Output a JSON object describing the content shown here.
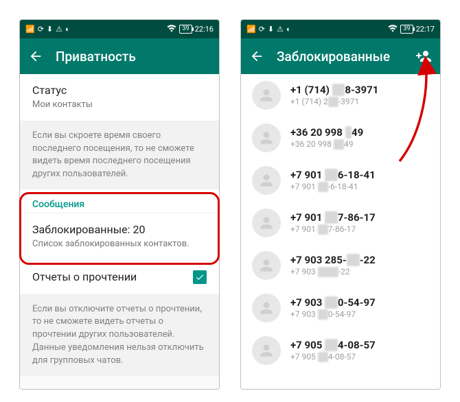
{
  "colors": {
    "teal_dark": "#004d40",
    "teal": "#00796b",
    "accent": "#009688",
    "highlight": "#d60000"
  },
  "left": {
    "status": {
      "time": "22:16",
      "battery": "39",
      "icons": [
        "signal",
        "sync",
        "download",
        "warn",
        "refresh"
      ],
      "wifi": true
    },
    "appbar": {
      "title": "Приватность"
    },
    "status_row": {
      "label": "Статус",
      "value": "Мои контакты"
    },
    "caption1": "Если вы скроете время своего последнего посещения, то не сможете видеть время последнего посещения других пользователей.",
    "section": "Сообщения",
    "blocked_row": {
      "label": "Заблокированные: 20",
      "sub": "Список заблокированных контактов."
    },
    "readreceipts": {
      "label": "Отчеты о прочтении",
      "checked": true
    },
    "caption2": "Если вы отключите отчеты о прочтении, то не сможете видеть отчеты о прочтении других пользователей. Данные уведомления нельзя отключить для групповых чатов."
  },
  "right": {
    "status": {
      "time": "22:17",
      "battery": "39",
      "icons": [
        "signal",
        "sync",
        "download",
        "warn",
        "refresh"
      ],
      "wifi": true
    },
    "appbar": {
      "title": "Заблокированные"
    },
    "contacts": [
      {
        "p_a": "+1 (714) ",
        "p_m": "XX",
        "p_b": "8-3971",
        "s_a": "+1 (714) 2",
        "s_m": "XX",
        "s_b": "-3971"
      },
      {
        "p_a": "+36 20 998 ",
        "p_m": "X",
        "p_b": "49",
        "s_a": "+36 20 998 ",
        "s_m": "XX",
        "s_b": "49"
      },
      {
        "p_a": "+7 901 ",
        "p_m": "XX",
        "p_b": "6-18-41",
        "s_a": "+7 901 ",
        "s_m": "XX",
        "s_b": "-6-18-41"
      },
      {
        "p_a": "+7 901 ",
        "p_m": "XX",
        "p_b": "7-86-17",
        "s_a": "+7 901 ",
        "s_m": "XX",
        "s_b": "7-86-17"
      },
      {
        "p_a": "+7 903 285-",
        "p_m": "XX",
        "p_b": "-22",
        "s_a": "+7 903 ",
        "s_m": "XXXX",
        "s_b": "-22"
      },
      {
        "p_a": "+7 903 ",
        "p_m": "XX",
        "p_b": "0-54-97",
        "s_a": "+7 903 ",
        "s_m": "XX",
        "s_b": "0-54-97"
      },
      {
        "p_a": "+7 905 ",
        "p_m": "XX",
        "p_b": "4-08-57",
        "s_a": "+7 905 ",
        "s_m": "XX",
        "s_b": "4-08-57"
      }
    ]
  }
}
